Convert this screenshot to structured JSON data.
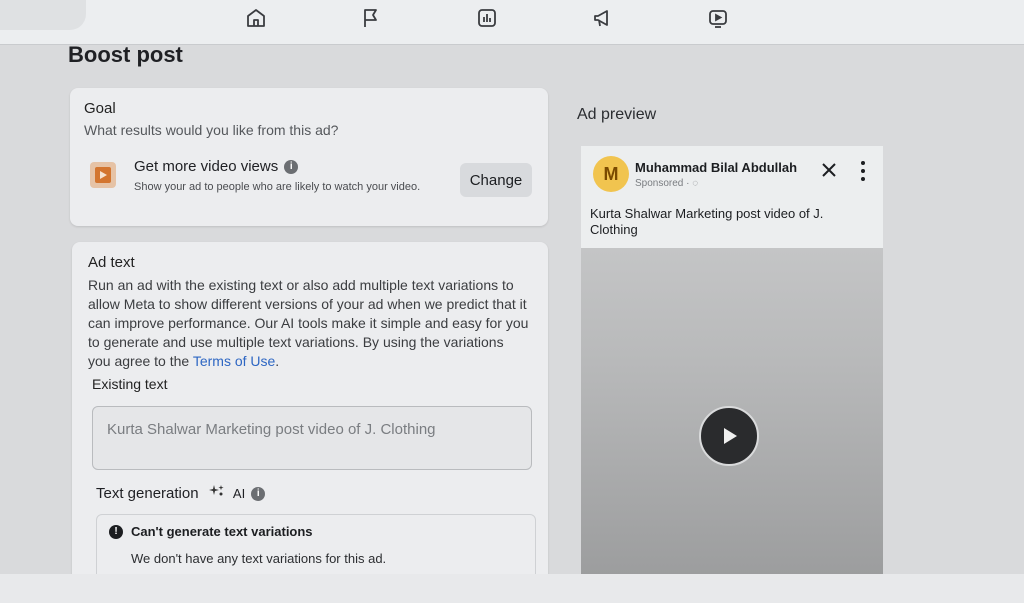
{
  "nav": {
    "icons": [
      "home-icon",
      "flag-icon",
      "insights-icon",
      "megaphone-icon",
      "video-icon"
    ]
  },
  "page": {
    "title": "Boost post"
  },
  "goal": {
    "heading": "Goal",
    "question": "What results would you like from this ad?",
    "option_title": "Get more video views",
    "option_desc": "Show your ad to people who are likely to watch your video.",
    "change_label": "Change"
  },
  "ad_text": {
    "heading": "Ad text",
    "description": "Run an ad with the existing text or also add multiple text variations to allow Meta to show different versions of your ad when we predict that it can improve performance. Our AI tools make it simple and easy for you to generate and use multiple text variations. By using the variations you agree to the ",
    "terms_link": "Terms of Use",
    "description_end": ".",
    "existing_label": "Existing text",
    "existing_value": "Kurta Shalwar Marketing post video of J. Clothing",
    "generation_label": "Text generation",
    "ai_label": "AI",
    "notice_title": "Can't generate text variations",
    "notice_body": "We don't have any text variations for this ad."
  },
  "preview": {
    "heading": "Ad preview",
    "page_name": "Muhammad Bilal Abdullah",
    "avatar_letter": "M",
    "sponsored": "Sponsored",
    "post_text": "Kurta Shalwar Marketing post video of J. Clothing"
  },
  "colors": {
    "link": "#2d66c3",
    "goal_icon": "#d3752f",
    "avatar": "#f1c44f"
  }
}
